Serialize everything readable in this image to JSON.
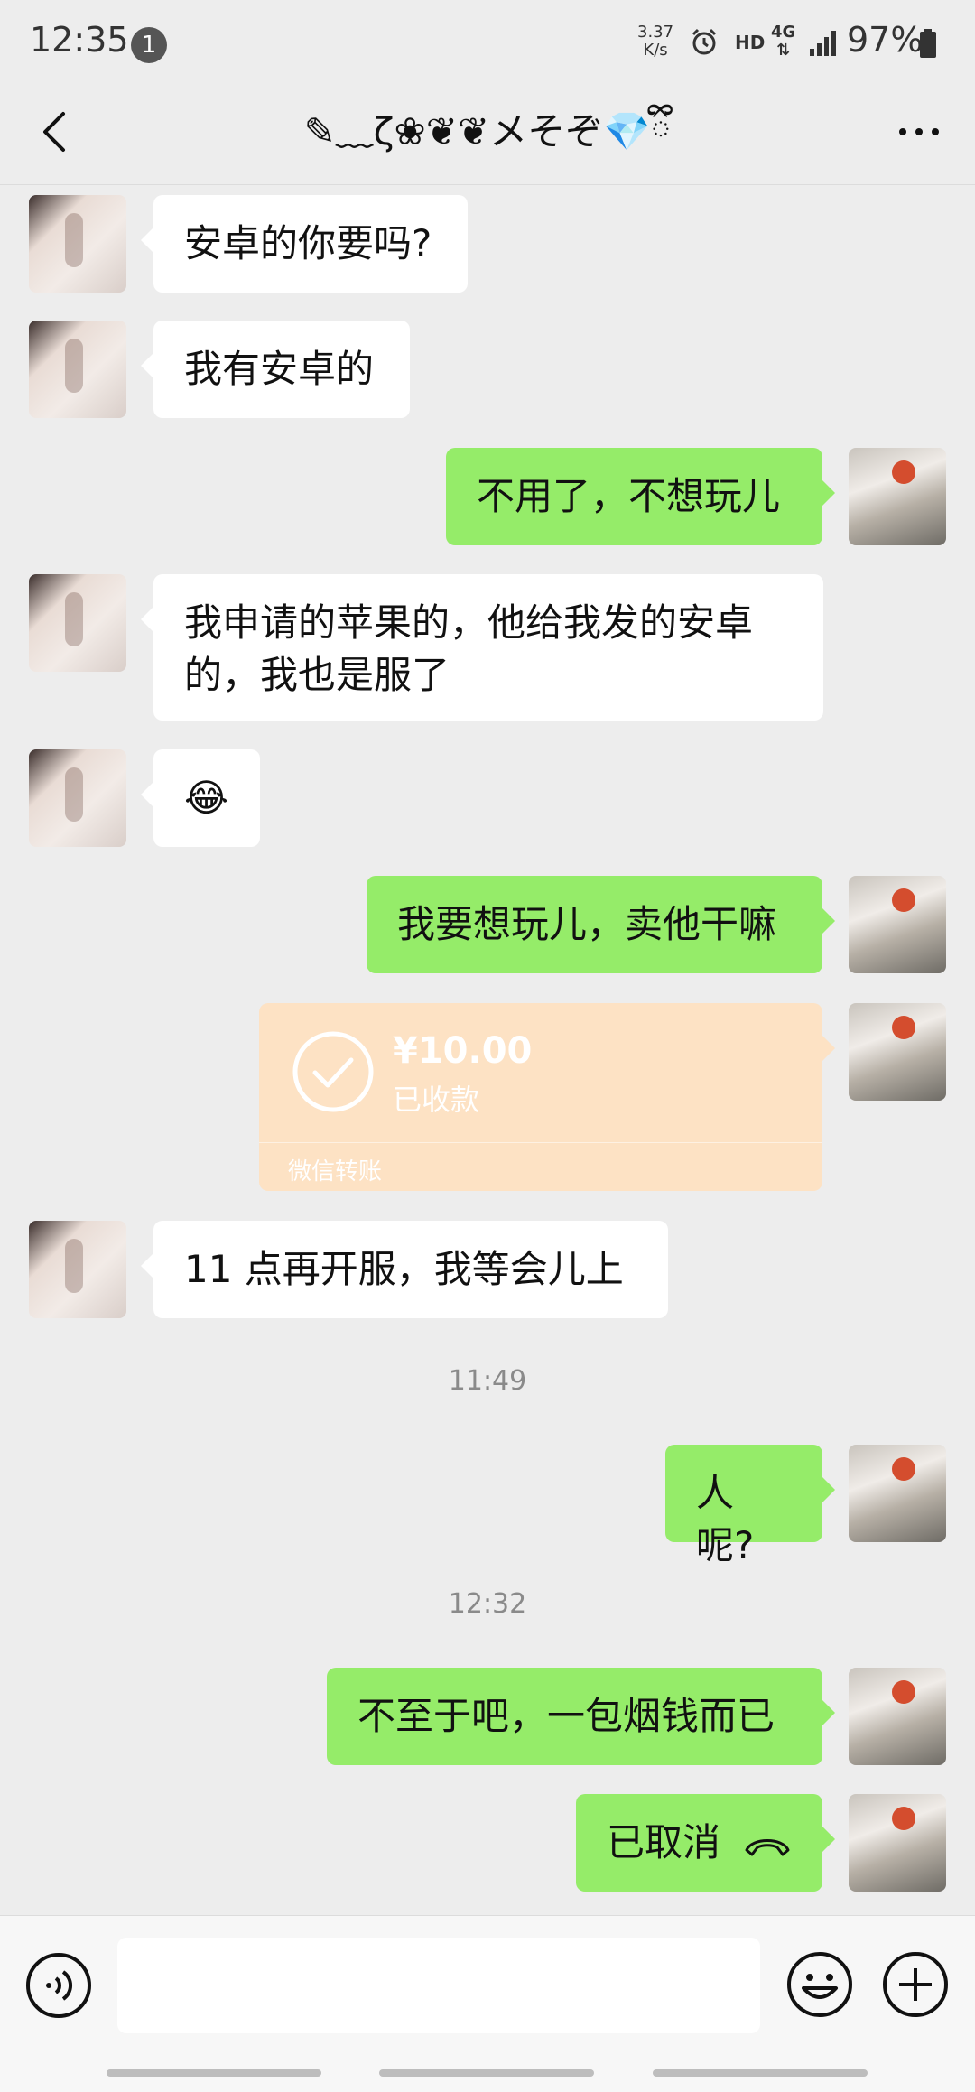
{
  "status_bar": {
    "time": "12:35",
    "notification_count": "1",
    "net_speed_value": "3.37",
    "net_speed_unit": "K/s",
    "hd": "HD",
    "network": "4G",
    "battery": "97%"
  },
  "header": {
    "title": "✎﹏ζ❀❦❦メそぞ💎ྀི"
  },
  "messages": [
    {
      "side": "in",
      "text": "安卓的你要吗?"
    },
    {
      "side": "in",
      "text": "我有安卓的"
    },
    {
      "side": "out",
      "text": "不用了，不想玩儿"
    },
    {
      "side": "in",
      "text": "我申请的苹果的，他给我发的安卓的，我也是服了"
    },
    {
      "side": "in",
      "text": "😂"
    },
    {
      "side": "out",
      "text": "我要想玩儿，卖他干嘛"
    },
    {
      "side": "in",
      "text": "11 点再开服，我等会儿上"
    },
    {
      "side": "out",
      "text": "人呢?"
    },
    {
      "side": "out",
      "text": "不至于吧，一包烟钱而已"
    },
    {
      "side": "out",
      "text": "已取消"
    }
  ],
  "transfer": {
    "amount": "¥10.00",
    "status": "已收款",
    "label": "微信转账"
  },
  "timestamps": [
    "11:49",
    "12:32"
  ],
  "input": {
    "placeholder": ""
  }
}
